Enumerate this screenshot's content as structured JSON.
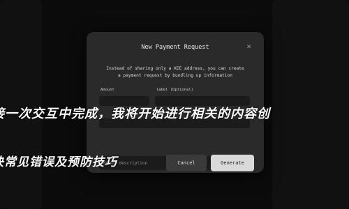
{
  "dialog": {
    "title": "New Payment Request",
    "close_icon": "×",
    "description_line1": "Instead of sharing only a KEE address, you can create",
    "description_line2": "a payment request by bundling up information",
    "amount_label": "Amount",
    "label_label": "label (Optional)",
    "description_placeholder": "Enter description",
    "cancel_label": "Cancel",
    "generate_label": "Generate"
  },
  "overlay": {
    "line1": "接一次交互中完成，我将开始进行相关的内容创",
    "line2": "决常见错误及预防技巧"
  }
}
